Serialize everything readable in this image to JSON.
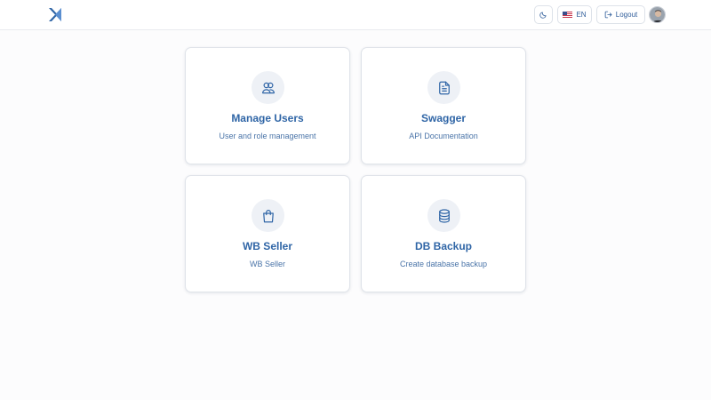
{
  "header": {
    "language_label": "EN",
    "logout_label": "Logout",
    "icons": {
      "logo": "logo-icon",
      "theme": "moon-icon",
      "flag": "us-flag-icon",
      "logout": "logout-icon"
    }
  },
  "cards": [
    {
      "title": "Manage Users",
      "description": "User and role management",
      "icon": "users-icon"
    },
    {
      "title": "Swagger",
      "description": "API Documentation",
      "icon": "document-icon"
    },
    {
      "title": "WB Seller",
      "description": "WB Seller",
      "icon": "shopping-bag-icon"
    },
    {
      "title": "DB Backup",
      "description": "Create database backup",
      "icon": "database-icon"
    }
  ],
  "colors": {
    "accent": "#2f65a6",
    "icon_bg": "#eef1f6",
    "border": "#dfe3e9",
    "background": "#fcfcfd"
  }
}
